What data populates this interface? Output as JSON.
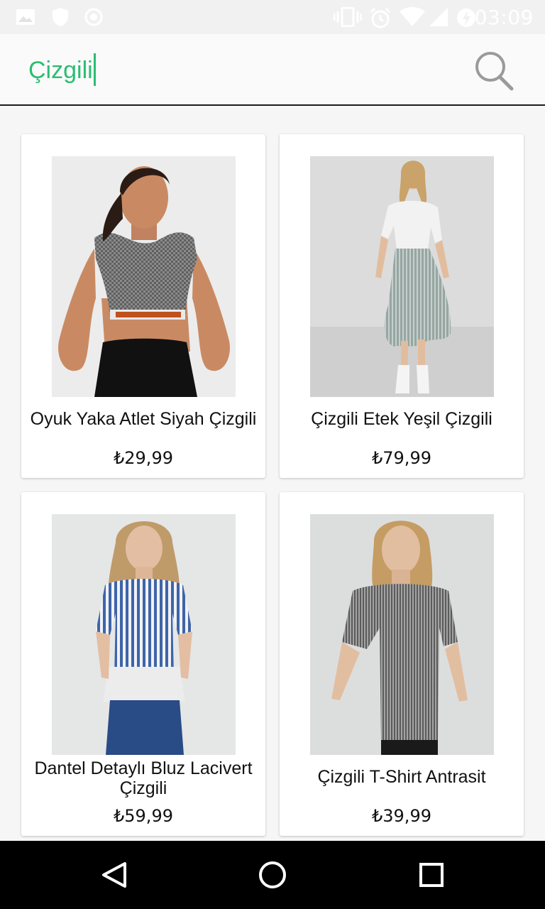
{
  "status_bar": {
    "time": "03:09",
    "left_icons": [
      "image-icon",
      "shield-icon",
      "record-icon"
    ],
    "right_icons": [
      "vibrate-icon",
      "alarm-icon",
      "wifi-icon",
      "signal-icon",
      "battery-charging-icon"
    ]
  },
  "search": {
    "value": "Çizgili",
    "accent_color": "#2bbd73"
  },
  "products": [
    {
      "name": "Oyuk Yaka Atlet Siyah Çizgili",
      "price": "₺29,99",
      "image": "black-white-checked-crop-top-photo"
    },
    {
      "name": "Çizgili Etek Yeşil Çizgili",
      "price": "₺79,99",
      "image": "green-striped-ruffle-skirt-photo"
    },
    {
      "name": "Dantel Detaylı Bluz Lacivert Çizgili",
      "price": "₺59,99",
      "image": "blue-striped-lace-blouse-photo"
    },
    {
      "name": "Çizgili T-Shirt Antrasit",
      "price": "₺39,99",
      "image": "anthracite-pleated-tshirt-photo"
    }
  ],
  "nav": {
    "buttons": [
      "back-icon",
      "home-icon",
      "recents-icon"
    ]
  }
}
